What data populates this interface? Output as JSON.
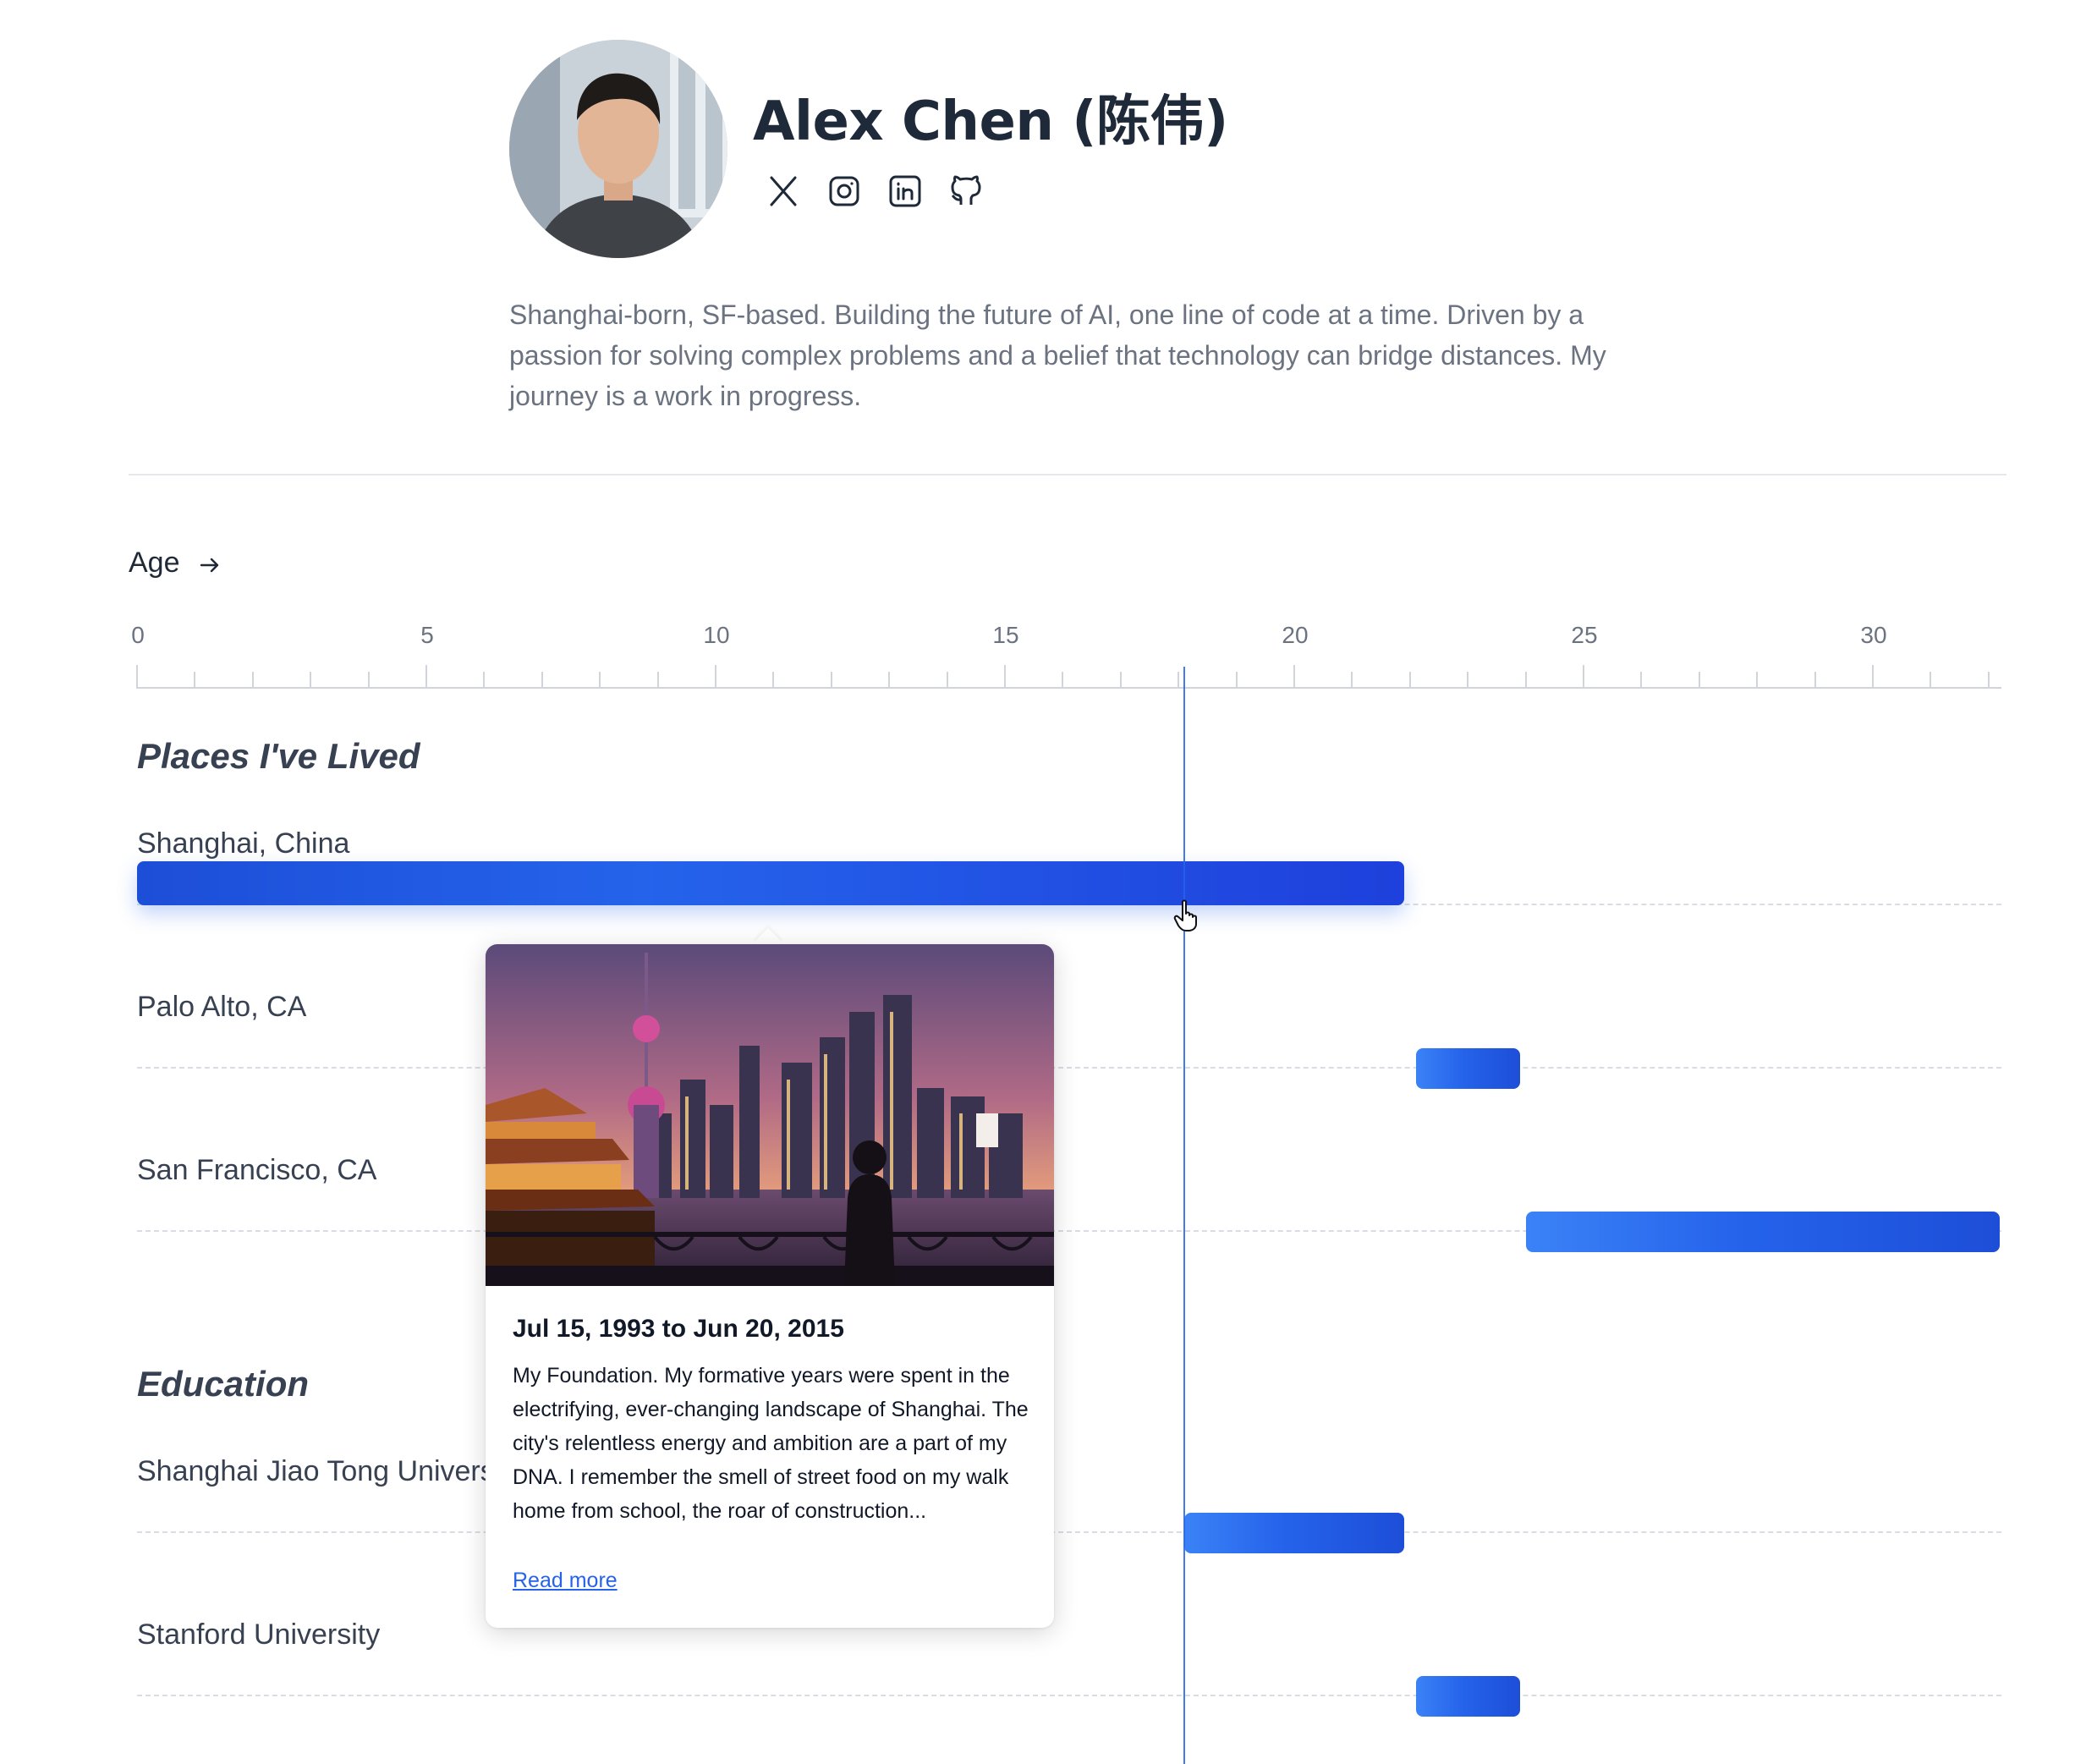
{
  "profile": {
    "name": "Alex Chen (陈伟)",
    "bio": "Shanghai-born, SF-based. Building the future of AI, one line of code at a time. Driven by a passion for solving complex problems and a belief that technology can bridge distances. My journey is a work in progress.",
    "social": [
      {
        "icon": "x-icon"
      },
      {
        "icon": "instagram-icon"
      },
      {
        "icon": "linkedin-icon"
      },
      {
        "icon": "github-icon"
      }
    ]
  },
  "axis": {
    "label": "Age",
    "ticks": [
      "0",
      "5",
      "10",
      "15",
      "20",
      "25",
      "30"
    ],
    "min": 0,
    "max": 32.2,
    "cursor_age": 18.1
  },
  "sections": [
    {
      "title": "Places I've Lived",
      "rows": [
        {
          "label": "Shanghai, China",
          "start": 0,
          "end": 21.9
        },
        {
          "label": "Palo Alto, CA",
          "start": 22.1,
          "end": 23.9
        },
        {
          "label": "San Francisco, CA",
          "start": 24.0,
          "end": 32.2
        }
      ]
    },
    {
      "title": "Education",
      "rows": [
        {
          "label": "Shanghai Jiao Tong University",
          "start": 18.1,
          "end": 21.9
        },
        {
          "label": "Stanford University",
          "start": 22.1,
          "end": 23.9
        }
      ]
    }
  ],
  "popover": {
    "date_range": "Jul 15, 1993 to Jun 20, 2015",
    "text": "My Foundation. My formative years were spent in the electrifying, ever-changing landscape of Shanghai. The city's relentless energy and ambition are a part of my DNA. I remember the smell of street food on my walk home from school, the roar of construction...",
    "link": "Read more"
  },
  "colors": {
    "accent": "#2563eb",
    "heading": "#1e2939",
    "muted": "#6b7280"
  }
}
